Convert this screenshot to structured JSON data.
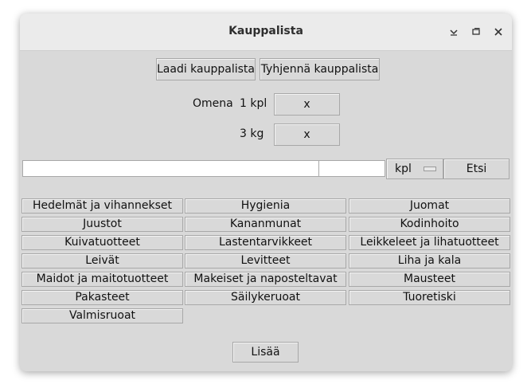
{
  "window": {
    "title": "Kauppalista",
    "controls": {
      "minimize_icon": "chevron-down-icon",
      "maximize_icon": "restore-icon",
      "close_icon": "close-icon"
    }
  },
  "toolbar": {
    "make_list_label": "Laadi kauppalista",
    "clear_list_label": "Tyhjennä kauppalista"
  },
  "list_items": [
    {
      "name": "Omena",
      "amount": "1 kpl",
      "remove_label": "x"
    },
    {
      "name": "",
      "amount": "3 kg",
      "remove_label": "x"
    }
  ],
  "search": {
    "item_value": "",
    "amount_value": "",
    "unit_selected": "kpl",
    "search_label": "Etsi"
  },
  "categories": [
    "Hedelmät ja vihannekset",
    "Hygienia",
    "Juomat",
    "Juustot",
    "Kananmunat",
    "Kodinhoito",
    "Kuivatuotteet",
    "Lastentarvikkeet",
    "Leikkeleet ja lihatuotteet",
    "Leivät",
    "Levitteet",
    "Liha ja kala",
    "Maidot ja maitotuotteet",
    "Makeiset ja naposteltavat",
    "Mausteet",
    "Pakasteet",
    "Säilykeruoat",
    "Tuoretiski",
    "Valmisruoat"
  ],
  "footer": {
    "add_label": "Lisää"
  }
}
